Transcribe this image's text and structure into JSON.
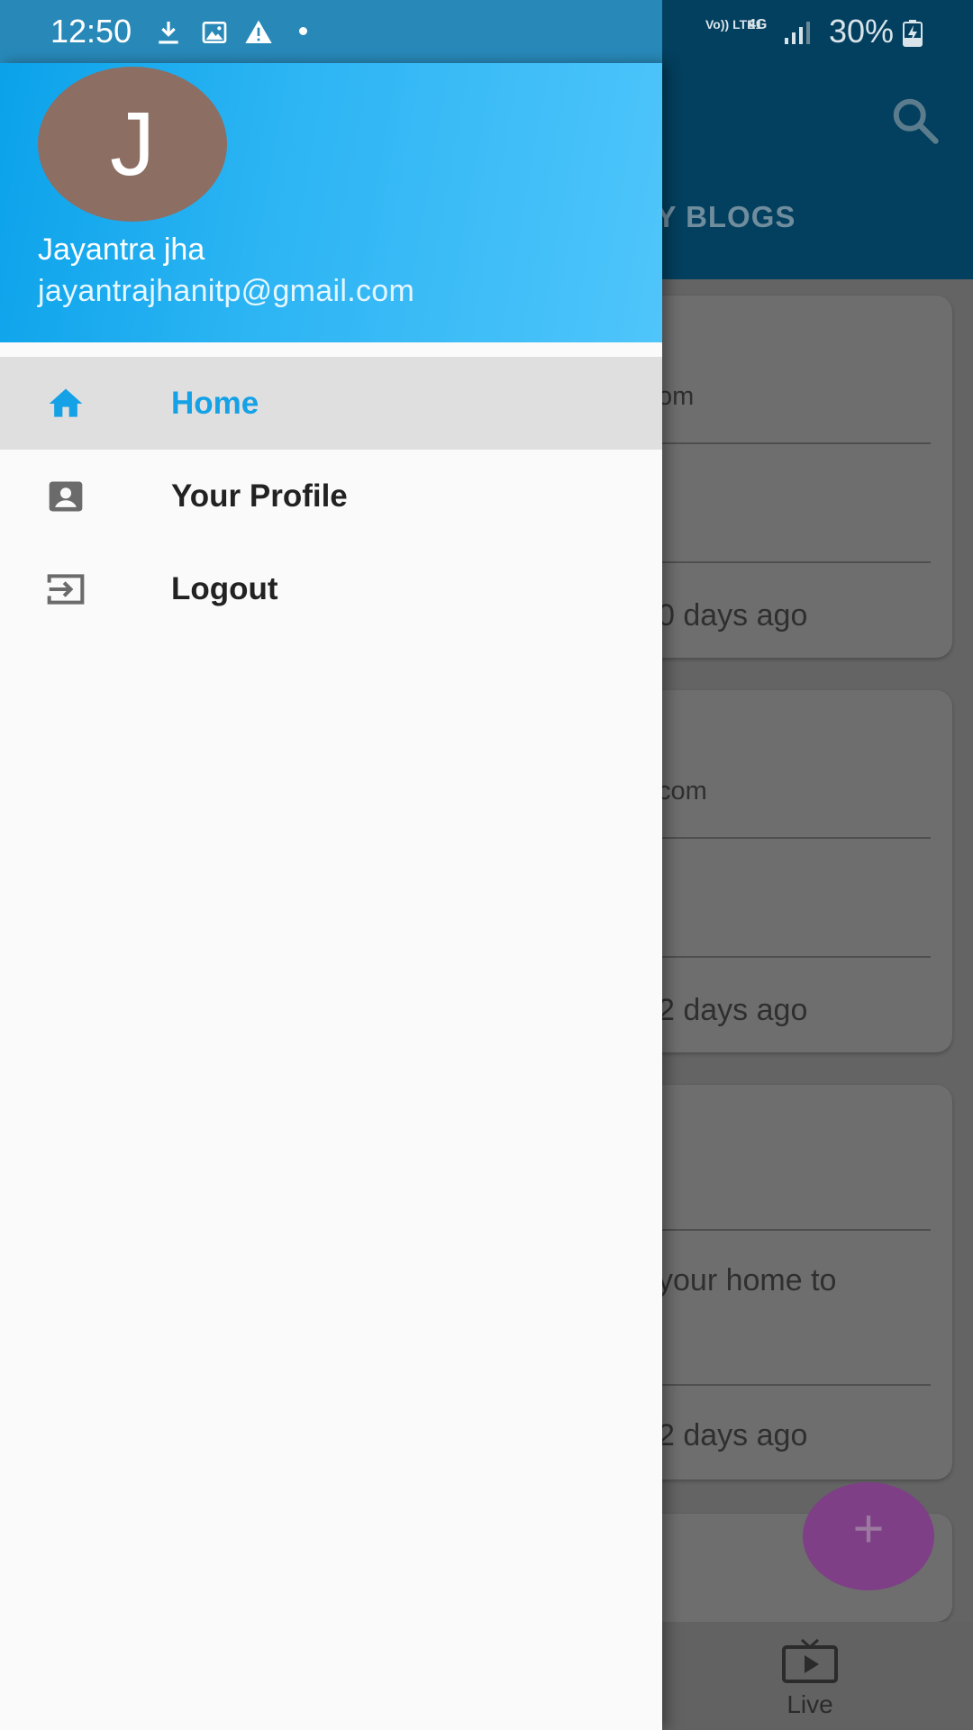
{
  "status_bar": {
    "time": "12:50",
    "network_label": "Vo)) LTE1",
    "network_type": "4G",
    "battery": "30%",
    "icons": [
      "download-icon",
      "image-icon",
      "warning-icon",
      "notification-dot-icon",
      "signal-icon",
      "battery-charging-icon"
    ]
  },
  "background_app": {
    "tab_label": "MY BLOGS",
    "cards": [
      {
        "line1": "om",
        "line3": "0 days ago"
      },
      {
        "line1": "com",
        "line3": "2 days ago"
      },
      {
        "line2": "your home to",
        "line3": "2 days ago"
      }
    ],
    "fab_label": "+",
    "bottom_nav": {
      "live_label": "Live"
    },
    "icons": [
      "search-icon",
      "live-tv-icon",
      "add-icon"
    ]
  },
  "drawer": {
    "avatar_initial": "J",
    "user_name": "Jayantra jha",
    "user_email": "jayantrajhanitp@gmail.com",
    "menu": [
      {
        "label": "Home",
        "icon": "home-icon",
        "selected": true
      },
      {
        "label": "Your Profile",
        "icon": "account-box-icon",
        "selected": false
      },
      {
        "label": "Logout",
        "icon": "logout-icon",
        "selected": false
      }
    ]
  },
  "colors": {
    "drawer_header_gradient": [
      "#0ba2ea",
      "#4fc5fb"
    ],
    "selected_text": "#14a1e6",
    "avatar_bg": "#8d6e63",
    "fab": "#7e3f87",
    "appbar": "#033f5e"
  }
}
